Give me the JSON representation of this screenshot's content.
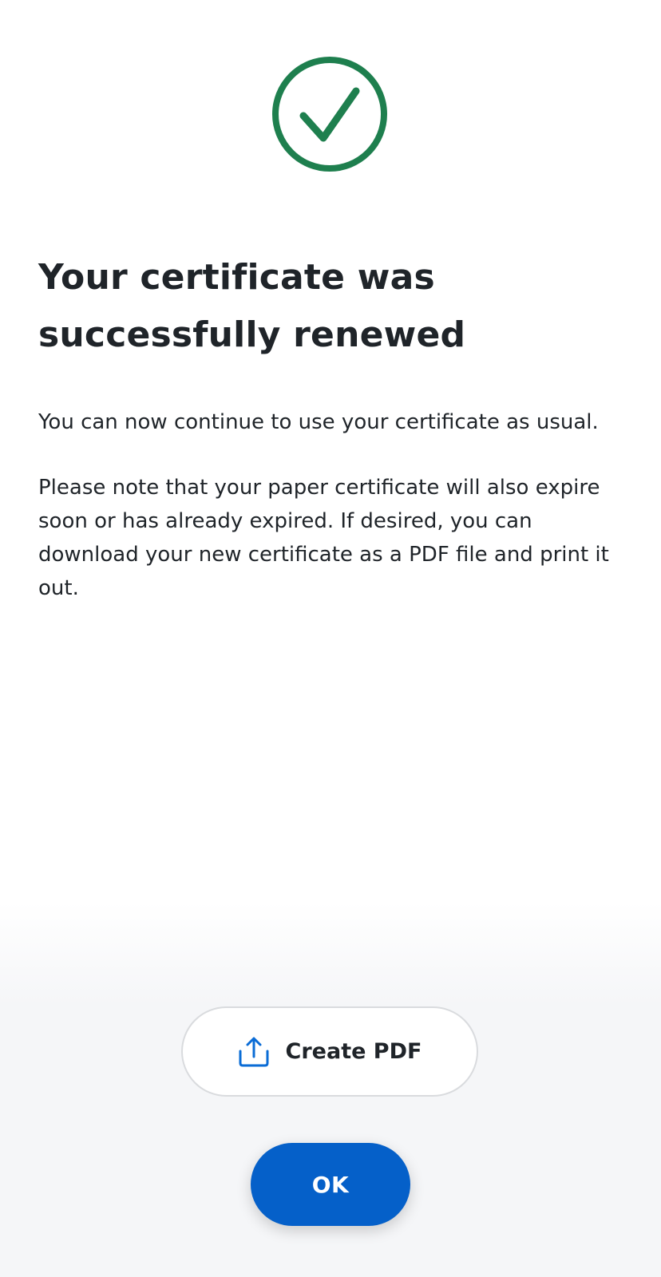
{
  "status": {
    "icon": "check-circle-icon",
    "color": "#1e7f4e"
  },
  "message": {
    "title": "Your certificate was successfully renewed",
    "paragraph_1": "You can now continue to use your certificate as usual.",
    "paragraph_2": "Please note that your paper certificate will also expire soon or has already expired. If desired, you can download your new certificate as a PDF file and print it out."
  },
  "actions": {
    "create_pdf": {
      "label": "Create PDF",
      "icon": "share-upload-icon",
      "icon_color": "#0a6cd6"
    },
    "ok": {
      "label": "OK",
      "color": "#0560c9"
    }
  }
}
